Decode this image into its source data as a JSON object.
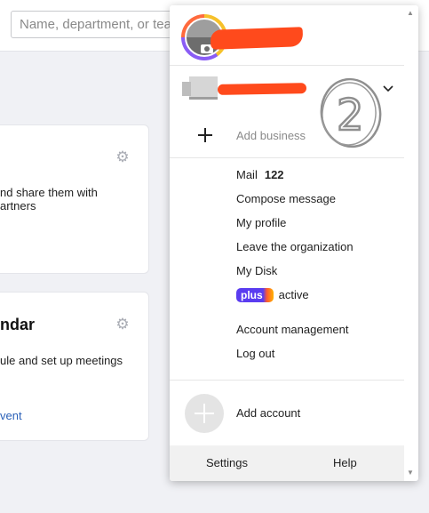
{
  "search": {
    "placeholder": "Name, department, or team"
  },
  "cards": [
    {
      "title": "",
      "text_lines": [
        "nd share them with",
        "artners"
      ],
      "link": ""
    },
    {
      "title": "ndar",
      "text_lines": [
        "ule and set up meetings"
      ],
      "link": "vent"
    }
  ],
  "menu": {
    "add_business": "Add business",
    "items": [
      {
        "label": "Mail",
        "count": "122"
      },
      {
        "label": "Compose message"
      },
      {
        "label": "My profile"
      },
      {
        "label": "Leave the organization"
      },
      {
        "label": "My Disk"
      },
      {
        "badge": "plus",
        "status": "active"
      },
      {
        "label": "Account management"
      },
      {
        "label": "Log out"
      }
    ],
    "add_account": "Add account",
    "footer": {
      "settings": "Settings",
      "help": "Help"
    },
    "annotation": "2"
  },
  "colors": {
    "redaction": "#ff4a1c",
    "plus_badge": "#5a3cf0",
    "link": "#2b61b8"
  },
  "icons": [
    "gear-icon",
    "camera-icon",
    "chevron-down-icon",
    "plus-icon",
    "add-account-icon"
  ]
}
